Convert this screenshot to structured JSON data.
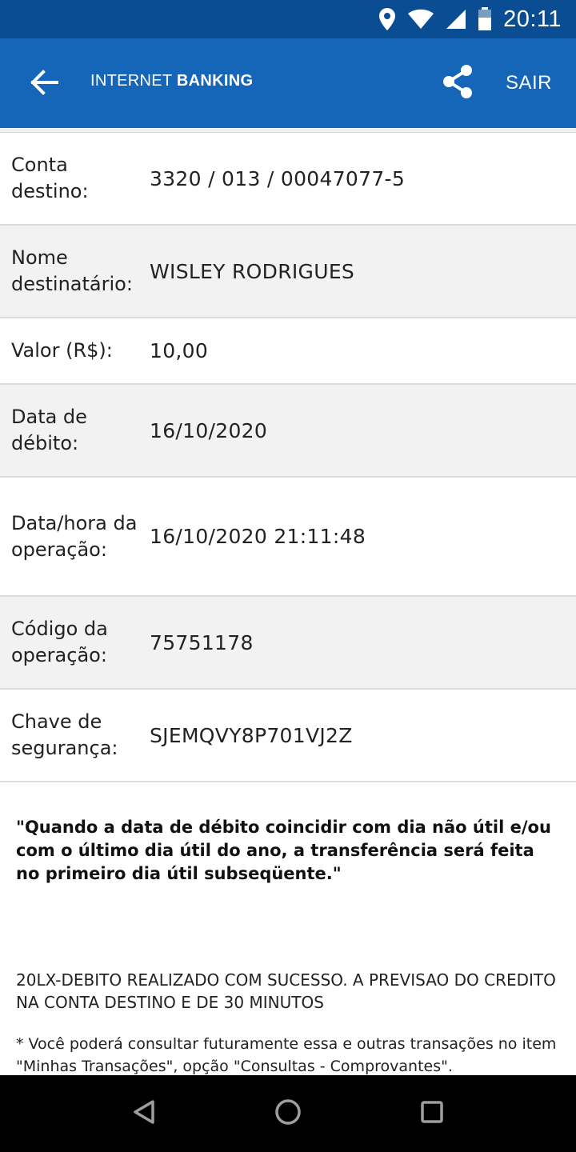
{
  "status_bar": {
    "time": "20:11",
    "icons": [
      "location-icon",
      "wifi-icon",
      "signal-icon",
      "battery-icon"
    ]
  },
  "app_bar": {
    "title_regular": "INTERNET ",
    "title_bold": "BANKING",
    "share_icon": "share-icon",
    "back_icon": "arrow-left-icon",
    "sair_label": "SAIR",
    "color": "#1565b8",
    "status_color": "#0a4d92"
  },
  "details": [
    {
      "label": "Conta destino:",
      "value": "3320 / 013 / 00047077-5"
    },
    {
      "label": "Nome destinatário:",
      "value": "WISLEY RODRIGUES"
    },
    {
      "label": "Valor (R$):",
      "value": "10,00"
    },
    {
      "label": "Data de débito:",
      "value": "16/10/2020"
    },
    {
      "label": "Data/hora da operação:",
      "value": "16/10/2020 21:11:48"
    },
    {
      "label": "Código da operação:",
      "value": "75751178"
    },
    {
      "label": "Chave de segurança:",
      "value": "SJEMQVY8P701VJ2Z"
    }
  ],
  "notice": "\"Quando a data de débito coincidir com dia não útil e/ou com o último dia útil do ano, a transferência será feita no primeiro dia útil subseqüente.\"",
  "result_message": "20LX-DEBITO REALIZADO COM SUCESSO. A PREVISAO DO CREDITO NA CONTA DESTINO E DE 30 MINUTOS",
  "footnote": "* Você poderá consultar futuramente essa e outras transações no item \"Minhas Transações\", opção \"Consultas - Comprovantes\".",
  "nav_bar": {
    "icons": [
      "back-triangle-icon",
      "home-circle-icon",
      "recents-square-icon"
    ]
  }
}
